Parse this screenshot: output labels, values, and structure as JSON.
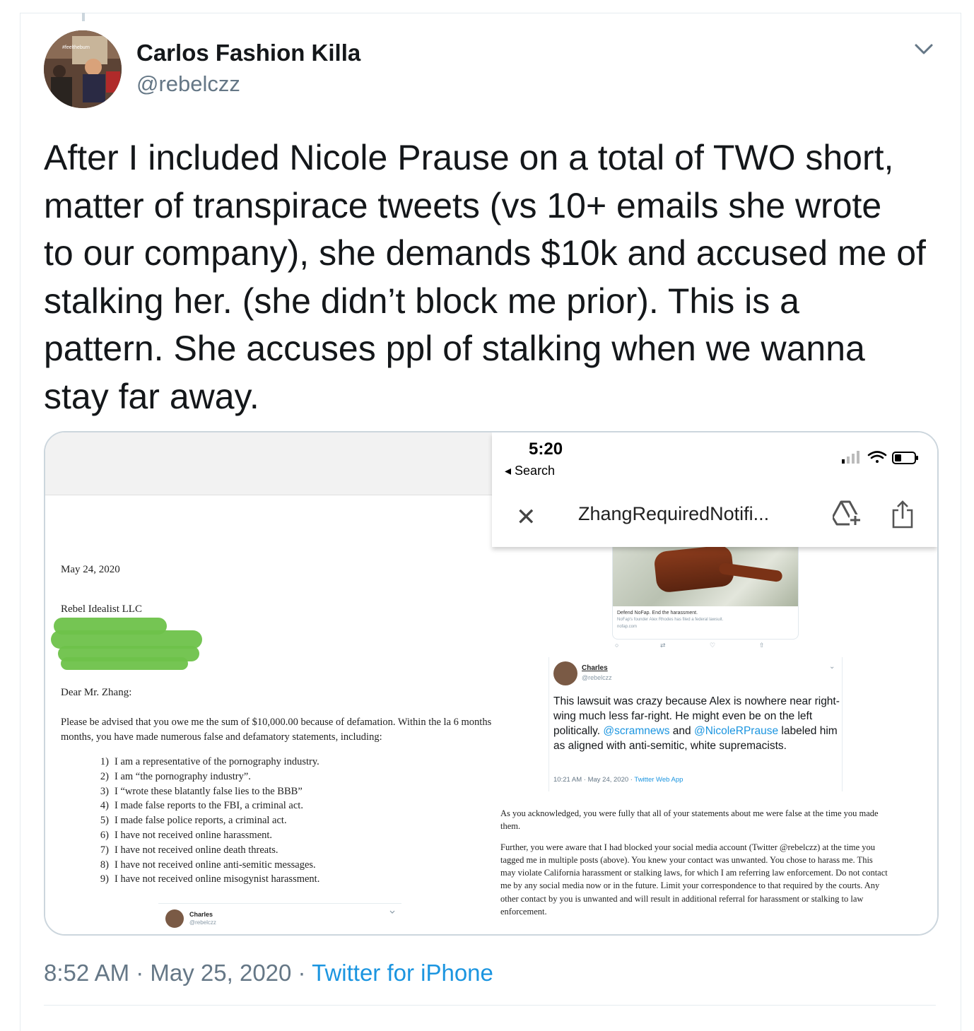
{
  "author": {
    "name": "Carlos Fashion Killa",
    "handle": "@rebelczz",
    "avatar_tag": "#feeltheburn"
  },
  "tweet": {
    "text": "After I included Nicole Prause on a total of TWO short,\nmatter of transpirace tweets (vs 10+ emails she wrote\nto our company), she demands $10k and accused me of\nstalking her. (she didn’t block me prior). This is a\npattern. She accuses ppl of stalking when we wanna\nstay far away.",
    "time": "8:52 AM",
    "sep1": " · ",
    "date": "May 25, 2020",
    "sep2": " · ",
    "source": "Twitter for iPhone"
  },
  "letter": {
    "date": "May 24, 2020",
    "company": "Rebel Idealist LLC",
    "greeting": "Dear Mr. Zhang:",
    "paragraph": "Please be advised that you owe me the sum of $10,000.00 because of defamation. Within the la 6 months months, you have made numerous false and defamatory statements, including:",
    "items": [
      {
        "n": "1)",
        "text": "I am a representative of the pornography industry."
      },
      {
        "n": "2)",
        "text": "I am “the pornography industry”."
      },
      {
        "n": "3)",
        "text": "I “wrote these blatantly false lies to the BBB”"
      },
      {
        "n": "4)",
        "text": "I made false reports to the FBI, a criminal act."
      },
      {
        "n": "5)",
        "text": "I made false police reports, a criminal act."
      },
      {
        "n": "6)",
        "text": "I have not received online harassment."
      },
      {
        "n": "7)",
        "text": "I have not received online death threats."
      },
      {
        "n": "8)",
        "text": "I have not received online anti-semitic messages."
      },
      {
        "n": "9)",
        "text": "I have not received online misogynist harassment."
      }
    ],
    "card_name": "Charles",
    "card_handle": "@rebelczz"
  },
  "phone": {
    "time": "5:20",
    "back_label": "◂ Search",
    "filename": "ZhangRequiredNotifi...",
    "close_icon": "✕",
    "embed_caption": "Defend NoFap. End the harassment.",
    "embed_sub": "NoFap's founder Alex Rhodes has filed a federal lawsuit.",
    "embed_link": "nofap.com",
    "tweet_name": "Charles",
    "tweet_handle": "@rebelczz",
    "tweet_text_a": "This lawsuit was crazy because Alex is nowhere near right-wing much less far-right. He might even be on the left politically. ",
    "mention1": "@scramnews",
    "tweet_text_b": " and ",
    "mention2": "@NicoleRPrause",
    "tweet_text_c": " labeled him as aligned with anti-semitic, white supremacists.",
    "tweet_meta": "10:21 AM · May 24, 2020 · ",
    "tweet_app": "Twitter Web App",
    "letter_p1": "As you acknowledged, you were fully that all of your statements about me were false at the time you made them.",
    "letter_p2": "Further, you were aware that I had blocked your social media account (Twitter @rebelczz) at the time you tagged me in multiple posts (above). You knew your contact was unwanted. You chose to harass me. This may violate California harassment or stalking laws, for which I am referring law enforcement. Do not contact me by any social media now or in the future. Limit your correspondence to that required by the courts. Any other contact by you is unwanted and will result in additional referral for harassment or stalking to law enforcement."
  }
}
